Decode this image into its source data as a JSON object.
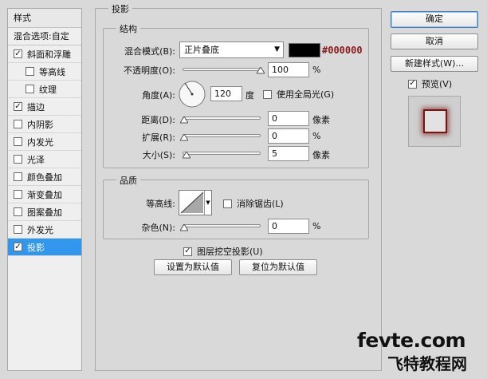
{
  "style_list": {
    "header": "样式",
    "blend_options": "混合选项:自定",
    "items": [
      {
        "label": "斜面和浮雕",
        "checked": true,
        "indent": false
      },
      {
        "label": "等高线",
        "checked": false,
        "indent": true
      },
      {
        "label": "纹理",
        "checked": false,
        "indent": true
      },
      {
        "label": "描边",
        "checked": true,
        "indent": false
      },
      {
        "label": "内阴影",
        "checked": false,
        "indent": false
      },
      {
        "label": "内发光",
        "checked": false,
        "indent": false
      },
      {
        "label": "光泽",
        "checked": false,
        "indent": false
      },
      {
        "label": "颜色叠加",
        "checked": false,
        "indent": false
      },
      {
        "label": "渐变叠加",
        "checked": false,
        "indent": false
      },
      {
        "label": "图案叠加",
        "checked": false,
        "indent": false
      },
      {
        "label": "外发光",
        "checked": false,
        "indent": false
      },
      {
        "label": "投影",
        "checked": true,
        "indent": false,
        "selected": true
      }
    ]
  },
  "panel": {
    "title": "投影",
    "structure": {
      "title": "结构",
      "blend_mode_label": "混合模式(B):",
      "blend_mode_value": "正片叠底",
      "color_hex": "#000000",
      "opacity_label": "不透明度(O):",
      "opacity_value": "100",
      "opacity_unit": "%",
      "angle_label": "角度(A):",
      "angle_value": "120",
      "angle_unit": "度",
      "global_light_label": "使用全局光(G)",
      "global_light_checked": false,
      "distance_label": "距离(D):",
      "distance_value": "0",
      "distance_unit": "像素",
      "spread_label": "扩展(R):",
      "spread_value": "0",
      "spread_unit": "%",
      "size_label": "大小(S):",
      "size_value": "5",
      "size_unit": "像素"
    },
    "quality": {
      "title": "品质",
      "contour_label": "等高线:",
      "antialias_label": "消除锯齿(L)",
      "antialias_checked": false,
      "noise_label": "杂色(N):",
      "noise_value": "0",
      "noise_unit": "%"
    },
    "knockout_label": "图层挖空投影(U)",
    "knockout_checked": true,
    "make_default": "设置为默认值",
    "reset_default": "复位为默认值"
  },
  "right": {
    "ok": "确定",
    "cancel": "取消",
    "new_style": "新建样式(W)...",
    "preview_label": "预览(V)",
    "preview_checked": true
  },
  "watermark": {
    "line1": "fevte.com",
    "line2": "飞特教程网"
  },
  "colors": {
    "selected_bg": "#3296ed",
    "shadow_color": "#000000",
    "hex_text": "#8b1a1a"
  }
}
